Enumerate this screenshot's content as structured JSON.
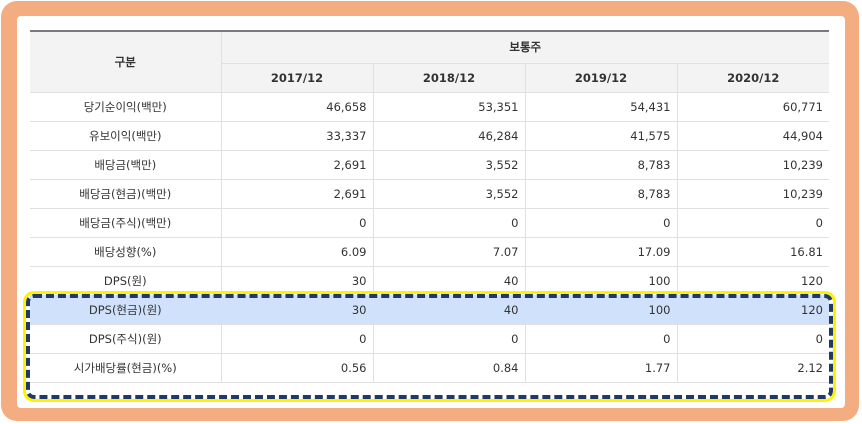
{
  "table": {
    "category_header": "구분",
    "group_header": "보통주",
    "years": [
      "2017/12",
      "2018/12",
      "2019/12",
      "2020/12"
    ],
    "rows": [
      {
        "label": "당기순이익(백만)",
        "values": [
          "46,658",
          "53,351",
          "54,431",
          "60,771"
        ]
      },
      {
        "label": "유보이익(백만)",
        "values": [
          "33,337",
          "46,284",
          "41,575",
          "44,904"
        ]
      },
      {
        "label": "배당금(백만)",
        "values": [
          "2,691",
          "3,552",
          "8,783",
          "10,239"
        ]
      },
      {
        "label": "배당금(현금)(백만)",
        "values": [
          "2,691",
          "3,552",
          "8,783",
          "10,239"
        ]
      },
      {
        "label": "배당금(주식)(백만)",
        "values": [
          "0",
          "0",
          "0",
          "0"
        ]
      },
      {
        "label": "배당성향(%)",
        "values": [
          "6.09",
          "7.07",
          "17.09",
          "16.81"
        ]
      },
      {
        "label": "DPS(원)",
        "values": [
          "30",
          "40",
          "100",
          "120"
        ]
      },
      {
        "label": "DPS(현금)(원)",
        "values": [
          "30",
          "40",
          "100",
          "120"
        ]
      },
      {
        "label": "DPS(주식)(원)",
        "values": [
          "0",
          "0",
          "0",
          "0"
        ]
      },
      {
        "label": "시가배당률(현금)(%)",
        "values": [
          "0.56",
          "0.84",
          "1.77",
          "2.12"
        ]
      }
    ]
  },
  "colors": {
    "frame": "#f4ad80",
    "highlight_row": "#cfe1fb",
    "dash_border": "#1f3a68",
    "dash_outline": "#fff200"
  }
}
